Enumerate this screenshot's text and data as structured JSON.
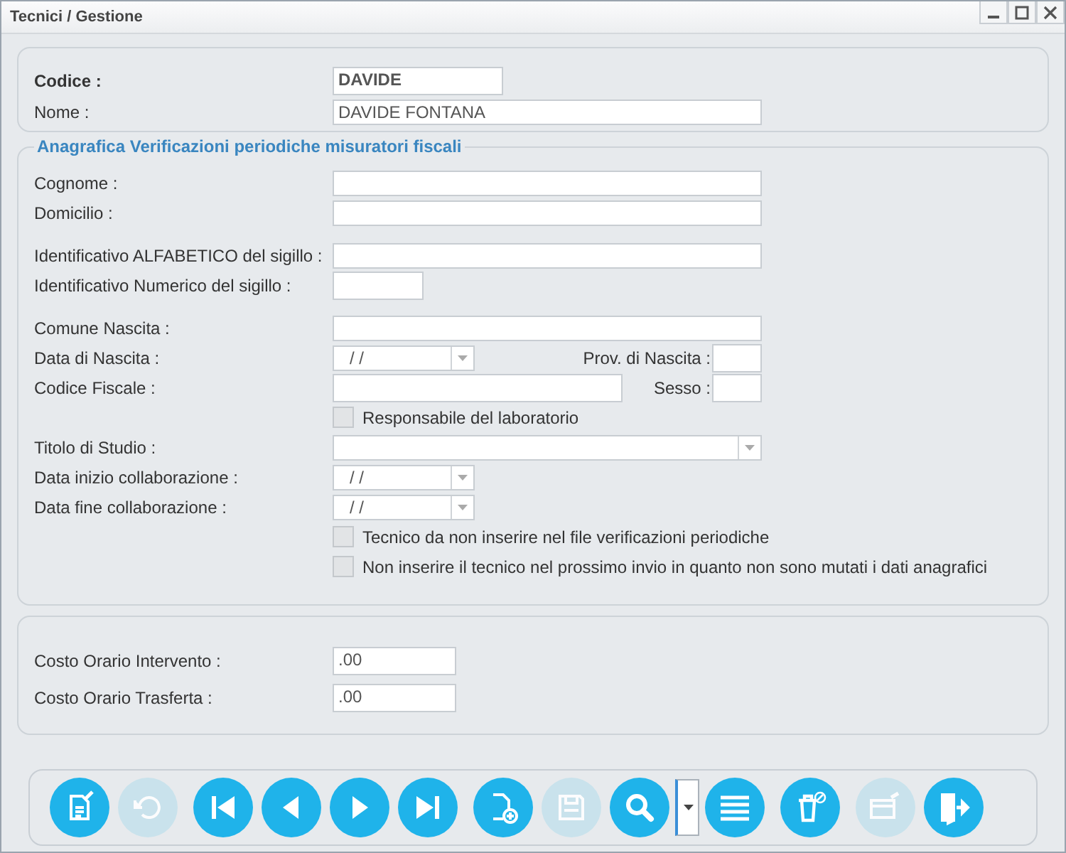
{
  "window": {
    "title": "Tecnici / Gestione"
  },
  "header": {
    "codice": {
      "label": "Codice :",
      "value": "DAVIDE"
    },
    "nome": {
      "label": "Nome :",
      "value": "DAVIDE FONTANA"
    }
  },
  "anagrafica": {
    "title": "Anagrafica Verificazioni periodiche misuratori fiscali",
    "groups": [
      [
        {
          "kind": "text",
          "label": "Cognome :"
        },
        {
          "kind": "text",
          "label": "Domicilio :"
        }
      ],
      [
        {
          "kind": "text",
          "label": "Identificativo ALFABETICO del sigillo :"
        },
        {
          "kind": "short",
          "label": "Identificativo Numerico del sigillo :"
        }
      ],
      [
        {
          "kind": "text",
          "label": "Comune Nascita :"
        },
        {
          "kind": "date_prov",
          "label": "Data di Nascita :",
          "value": "/ /",
          "label2": "Prov. di Nascita :"
        },
        {
          "kind": "cf_sesso",
          "label": "Codice Fiscale :",
          "label2": "Sesso :"
        },
        {
          "kind": "checkbox",
          "label": "Responsabile del laboratorio",
          "checked": false
        },
        {
          "kind": "combo",
          "label": "Titolo di Studio :"
        },
        {
          "kind": "date",
          "label": "Data inizio collaborazione :",
          "value": "/ /"
        },
        {
          "kind": "date",
          "label": "Data fine collaborazione :",
          "value": "/ /"
        },
        {
          "kind": "checkbox",
          "label": "Tecnico da non inserire nel file verificazioni periodiche",
          "checked": false
        },
        {
          "kind": "checkbox",
          "label": "Non inserire il tecnico nel prossimo invio in quanto non sono mutati i dati anagrafici",
          "checked": false
        }
      ]
    ]
  },
  "costi": [
    {
      "label": "Costo Orario Intervento :",
      "value": ".00"
    },
    {
      "label": "Costo Orario Trasferta :",
      "value": ".00"
    }
  ],
  "toolbar": [
    [
      {
        "kind": "edit",
        "disabled": false
      },
      {
        "kind": "undo",
        "disabled": true
      }
    ],
    [
      {
        "kind": "first",
        "disabled": false
      },
      {
        "kind": "prev",
        "disabled": false
      },
      {
        "kind": "next",
        "disabled": false
      },
      {
        "kind": "last",
        "disabled": false
      }
    ],
    [
      {
        "kind": "new",
        "disabled": false
      },
      {
        "kind": "save",
        "disabled": true
      },
      {
        "kind": "search",
        "disabled": false
      },
      {
        "kind": "dropdown",
        "disabled": false
      },
      {
        "kind": "list",
        "disabled": false
      }
    ],
    [
      {
        "kind": "delete",
        "disabled": false
      }
    ],
    [
      {
        "kind": "card",
        "disabled": true
      },
      {
        "kind": "exit",
        "disabled": false
      }
    ]
  ]
}
